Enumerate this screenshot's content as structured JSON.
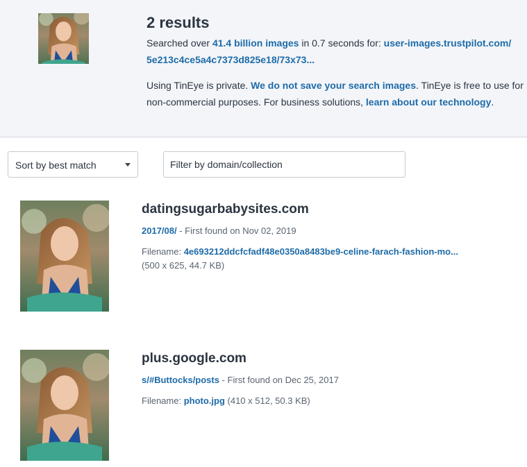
{
  "header": {
    "result_count": "2 results",
    "searched_prefix": "Searched over ",
    "images_count_link": "41.4 billion images",
    "searched_middle": " in 0.7 seconds for: ",
    "query_url": "user-images.trustpilot.com/5e213c4ce5a4c7373d825e18/73x73...",
    "privacy_prefix": "Using TinEye is private. ",
    "privacy_link": "We do not save your search images",
    "privacy_middle": ". TinEye is free to use for non-commercial purposes. For business solutions, ",
    "tech_link": "learn about our technology",
    "privacy_end": "."
  },
  "controls": {
    "sort_value": "Sort by best match",
    "filter_placeholder": "Filter by domain/collection"
  },
  "results": [
    {
      "domain": "datingsugarbabysites.com",
      "path_link": "2017/08/",
      "first_found": " - First found on Nov 02, 2019",
      "filename_label": "Filename: ",
      "filename_link": "4e693212ddcfcfadf48e0350a8483be9-celine-farach-fashion-mo...",
      "details": "(500 x 625, 44.7 KB)"
    },
    {
      "domain": "plus.google.com",
      "path_link": "s/#Buttocks/posts",
      "first_found": " - First found on Dec 25, 2017",
      "filename_label": "Filename: ",
      "filename_link": "photo.jpg",
      "details": " (410 x 512, 50.3 KB)"
    }
  ],
  "colors": {
    "header_bg": "#f3f5f9",
    "link": "#1e6ba8",
    "text": "#2b3440",
    "muted": "#5a6470"
  }
}
